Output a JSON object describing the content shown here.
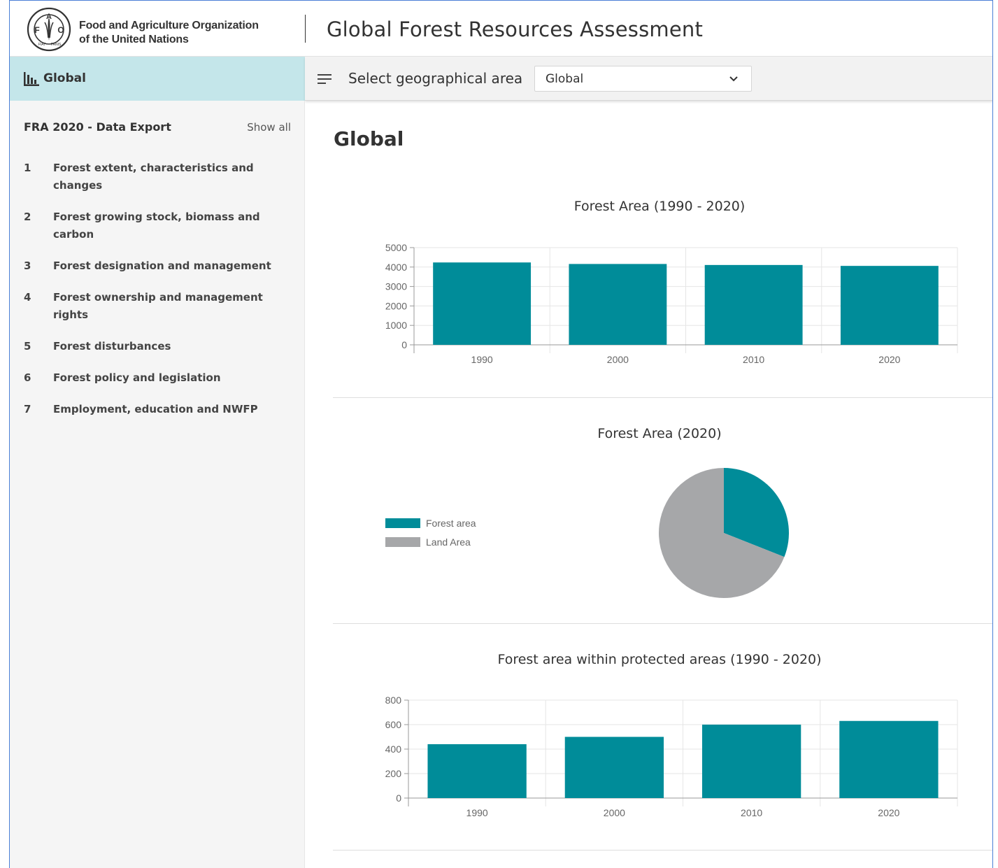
{
  "header": {
    "org_line1": "Food and Agriculture Organization",
    "org_line2": "of the United Nations",
    "logo_letters": "FAO",
    "logo_motto": "FIAT PANIS",
    "app_title": "Global Forest Resources Assessment"
  },
  "toolbar": {
    "sidebar_label": "Global",
    "select_label": "Select geographical area",
    "selected_area": "Global"
  },
  "sidebar": {
    "heading": "FRA 2020 - Data Export",
    "show_all": "Show all",
    "items": [
      {
        "num": "1",
        "label": "Forest extent, characteristics and changes"
      },
      {
        "num": "2",
        "label": "Forest growing stock, biomass and carbon"
      },
      {
        "num": "3",
        "label": "Forest designation and management"
      },
      {
        "num": "4",
        "label": "Forest ownership and management rights"
      },
      {
        "num": "5",
        "label": "Forest disturbances"
      },
      {
        "num": "6",
        "label": "Forest policy and legislation"
      },
      {
        "num": "7",
        "label": "Employment, education and NWFP"
      }
    ]
  },
  "main": {
    "page_title": "Global"
  },
  "colors": {
    "accent": "#008c99",
    "land": "#a6a7a9",
    "sidebar_active": "#c4e6ea"
  },
  "chart_data": [
    {
      "type": "bar",
      "title": "Forest Area (1990 - 2020)",
      "categories": [
        "1990",
        "2000",
        "2010",
        "2020"
      ],
      "values": [
        4236,
        4158,
        4106,
        4059
      ],
      "ylim": [
        0,
        5000
      ],
      "yticks": [
        0,
        1000,
        2000,
        3000,
        4000,
        5000
      ],
      "grid": true,
      "color": "#008c99"
    },
    {
      "type": "pie",
      "title": "Forest Area (2020)",
      "labels": [
        "Forest area",
        "Land Area"
      ],
      "values": [
        31,
        69
      ],
      "colors": [
        "#008c99",
        "#a6a7a9"
      ],
      "legend": "left"
    },
    {
      "type": "bar",
      "title": "Forest area within protected areas (1990 - 2020)",
      "categories": [
        "1990",
        "2000",
        "2010",
        "2020"
      ],
      "values": [
        440,
        500,
        600,
        630
      ],
      "ylim": [
        0,
        800
      ],
      "yticks": [
        0,
        200,
        400,
        600,
        800
      ],
      "grid": true,
      "color": "#008c99"
    }
  ]
}
